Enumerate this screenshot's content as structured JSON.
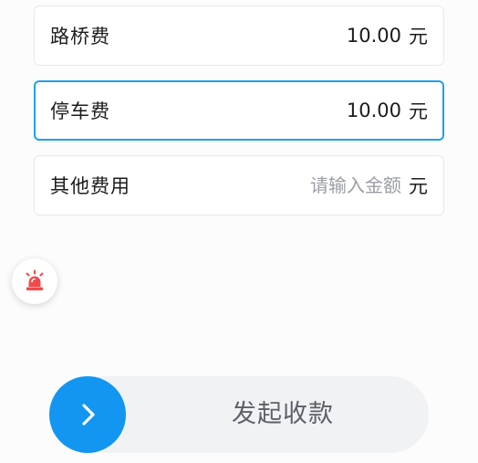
{
  "fees": {
    "toll": {
      "label": "路桥费",
      "value": "10.00",
      "unit": "元"
    },
    "parking": {
      "label": "停车费",
      "value": "10.00",
      "unit": "元"
    },
    "other": {
      "label": "其他费用",
      "value": "",
      "placeholder": "请输入金额",
      "unit": "元"
    }
  },
  "swipe": {
    "label": "发起收款"
  },
  "icons": {
    "alarm": "alarm-siren-icon",
    "swipe_arrow": "chevron-right-icon"
  },
  "colors": {
    "active_border": "#1ea1ea",
    "swipe_knob": "#1296f2",
    "alarm_red": "#f04a4a",
    "placeholder": "#9a9ea4"
  }
}
